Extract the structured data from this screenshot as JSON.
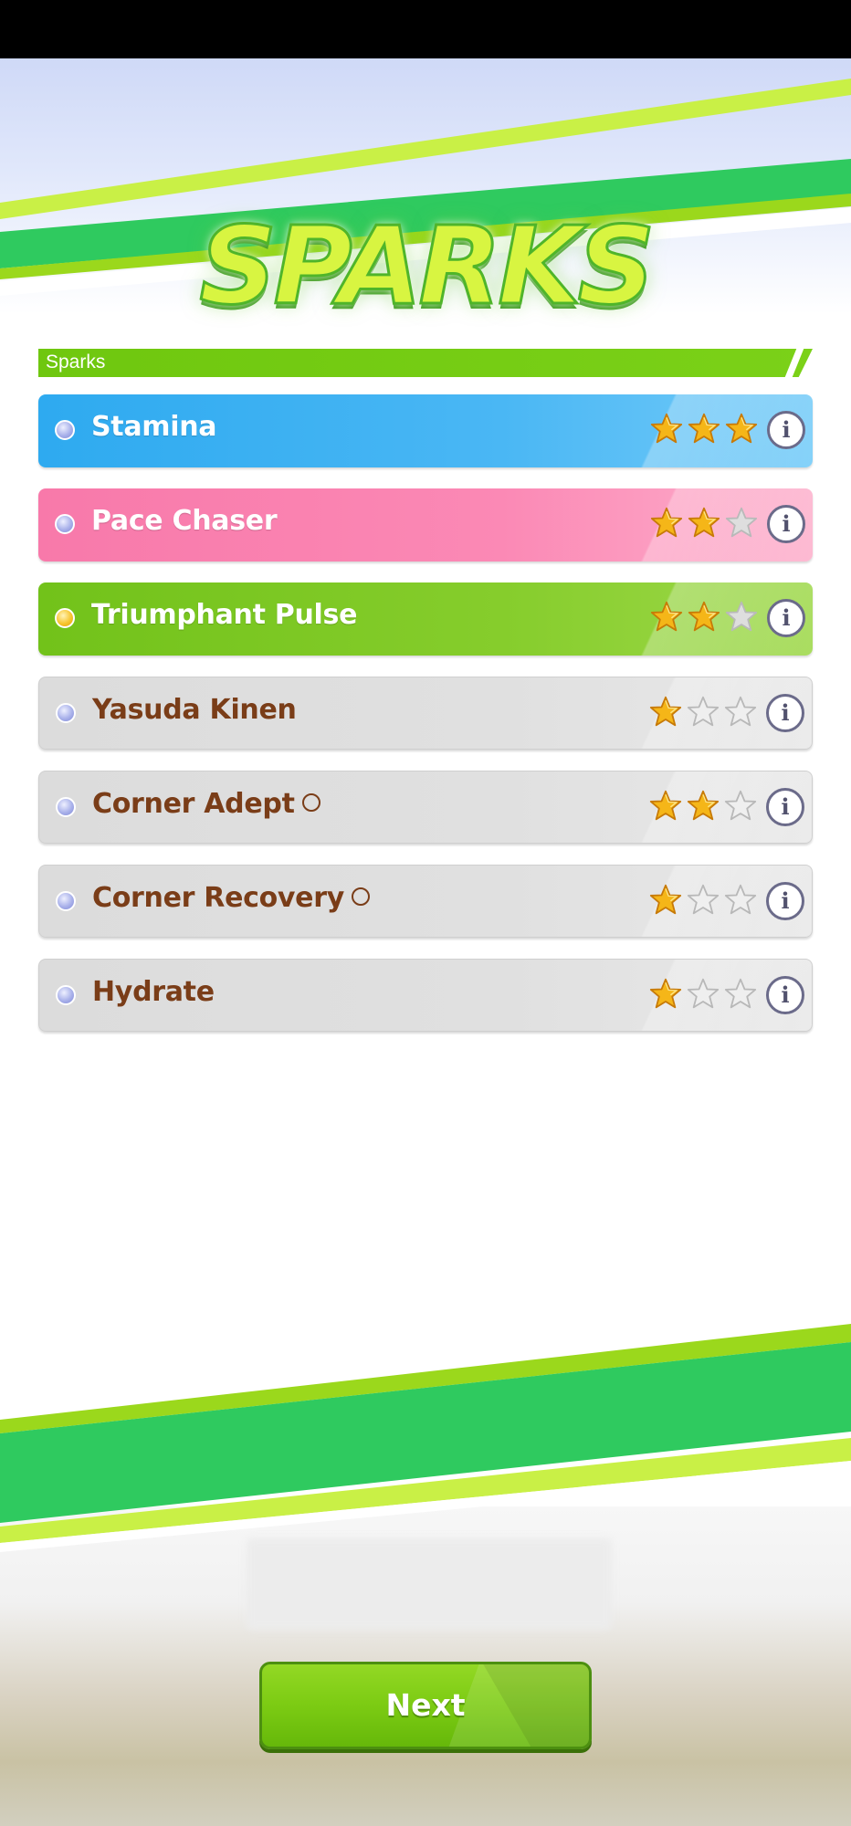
{
  "screen_title": "SPARKS",
  "section_header": "Sparks",
  "sparks": [
    {
      "label": "Stamina",
      "color": "blue",
      "dot": "blue",
      "stars": 3,
      "ring": false
    },
    {
      "label": "Pace Chaser",
      "color": "pink",
      "dot": "blue",
      "stars": 2,
      "ring": false
    },
    {
      "label": "Triumphant Pulse",
      "color": "green",
      "dot": "gold",
      "stars": 2,
      "ring": false
    },
    {
      "label": "Yasuda Kinen",
      "color": "gray",
      "dot": "blue",
      "stars": 1,
      "ring": false
    },
    {
      "label": "Corner Adept",
      "color": "gray",
      "dot": "blue",
      "stars": 2,
      "ring": true
    },
    {
      "label": "Corner Recovery",
      "color": "gray",
      "dot": "blue",
      "stars": 1,
      "ring": true
    },
    {
      "label": "Hydrate",
      "color": "gray",
      "dot": "blue",
      "stars": 1,
      "ring": false
    }
  ],
  "star_max": 3,
  "info_glyph": "i",
  "next_button": "Next",
  "colors": {
    "accent_green": "#7bd118",
    "blue_row": "#2eaaf0",
    "pink_row": "#f879aa",
    "green_row": "#72c21a",
    "gray_row": "#dcdcdc",
    "star_filled": "#f5b618",
    "gray_text": "#7a3d18"
  }
}
